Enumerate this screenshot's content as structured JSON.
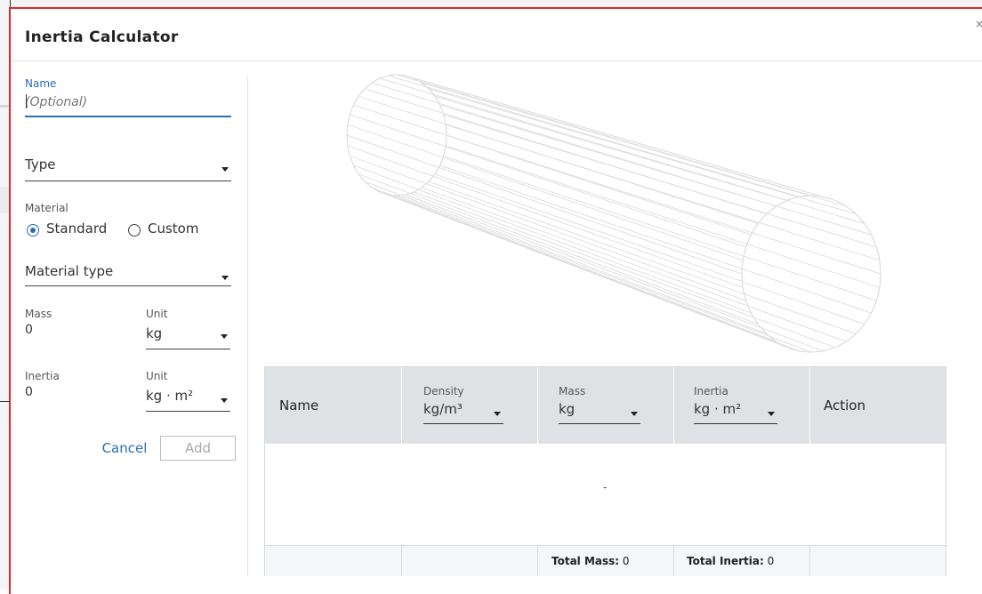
{
  "dialog": {
    "title": "Inertia Calculator",
    "close_glyph": "×"
  },
  "form": {
    "name_label": "Name",
    "name_placeholder": "(Optional)",
    "type_label": "Type",
    "material_label": "Material",
    "material_options": [
      "Standard",
      "Custom"
    ],
    "material_selected": "Standard",
    "material_type_label": "Material type",
    "mass_label": "Mass",
    "mass_value": "0",
    "mass_unit_label": "Unit",
    "mass_unit": "kg",
    "inertia_label": "Inertia",
    "inertia_value": "0",
    "inertia_unit_label": "Unit",
    "inertia_unit": "kg · m²",
    "cancel_label": "Cancel",
    "add_label": "Add"
  },
  "preview": {
    "icon": "cylinder-wireframe-icon"
  },
  "table": {
    "columns": [
      {
        "header": "Name"
      },
      {
        "header": "Density",
        "unit": "kg/m³"
      },
      {
        "header": "Mass",
        "unit": "kg"
      },
      {
        "header": "Inertia",
        "unit": "kg · m²"
      },
      {
        "header": "Action"
      }
    ],
    "empty_text": "-",
    "footer": {
      "total_mass_label": "Total Mass:",
      "total_mass_value": "0",
      "total_inertia_label": "Total Inertia:",
      "total_inertia_value": "0"
    }
  },
  "colors": {
    "accent": "#2a6ebb",
    "dialog_border": "#d9272e",
    "table_header": "#dfe2e5"
  }
}
